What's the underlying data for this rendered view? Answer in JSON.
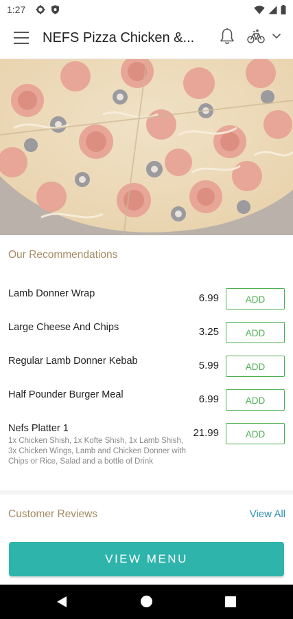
{
  "status_bar": {
    "time": "1:27",
    "icons": [
      "settings-icon",
      "shield-icon",
      "wifi-icon",
      "signal-icon",
      "battery-icon"
    ]
  },
  "header": {
    "title": "NEFS Pizza Chicken &...",
    "icons": [
      "menu-icon",
      "bell-icon",
      "bike-icon",
      "chevron-down-icon"
    ]
  },
  "hero": {
    "description_icon": "pizza-image"
  },
  "recommendations": {
    "title": "Our Recommendations",
    "add_label": "ADD",
    "items": [
      {
        "name": "Lamb Donner Wrap",
        "price": "6.99",
        "desc": ""
      },
      {
        "name": "Large Cheese And Chips",
        "price": "3.25",
        "desc": ""
      },
      {
        "name": "Regular Lamb Donner Kebab",
        "price": "5.99",
        "desc": ""
      },
      {
        "name": "Half Pounder Burger Meal",
        "price": "6.99",
        "desc": ""
      },
      {
        "name": "Nefs Platter 1",
        "price": "21.99",
        "desc": "1x Chicken Shish, 1x Kofte Shish, 1x Lamb Shish, 3x Chicken Wings, Lamb and Chicken Donner with Chips or Rice, Salad and a bottle of Drink"
      }
    ]
  },
  "reviews": {
    "title": "Customer Reviews",
    "view_all": "View All"
  },
  "cta": {
    "label": "VIEW MENU"
  },
  "colors": {
    "accent_teal": "#2fb4ac",
    "add_green": "#4caf50",
    "section_gold": "#a38b63",
    "link_blue": "#2f8fb3"
  }
}
